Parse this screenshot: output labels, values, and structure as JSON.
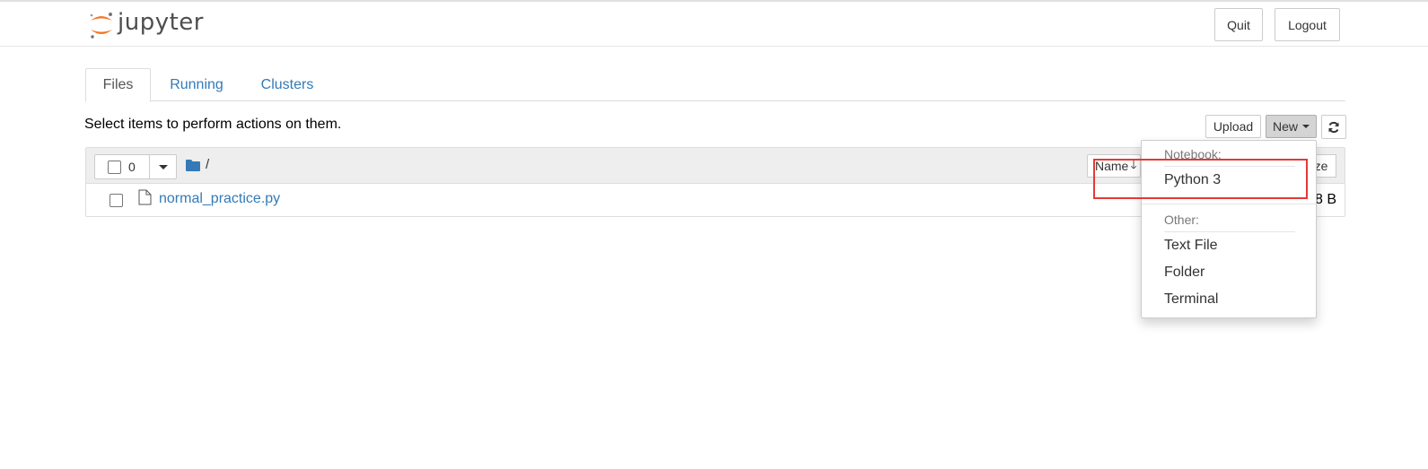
{
  "header": {
    "logo_text": "jupyter",
    "quit_label": "Quit",
    "logout_label": "Logout"
  },
  "tabs": [
    {
      "label": "Files",
      "active": true
    },
    {
      "label": "Running",
      "active": false
    },
    {
      "label": "Clusters",
      "active": false
    }
  ],
  "toolbar": {
    "hint": "Select items to perform actions on them.",
    "upload_label": "Upload",
    "new_label": "New"
  },
  "list": {
    "selected_count": "0",
    "breadcrumb_path": "/",
    "name_sort_label": "Name",
    "size_header_fragment": "ze",
    "files": [
      {
        "name": "normal_practice.py",
        "size_fragment": "8 B"
      }
    ]
  },
  "new_menu": {
    "notebook_header": "Notebook:",
    "python_label": "Python 3",
    "other_header": "Other:",
    "text_file_label": "Text File",
    "folder_label": "Folder",
    "terminal_label": "Terminal"
  },
  "colors": {
    "link": "#337ab7",
    "jupyter_orange": "#f37726",
    "highlight_red": "#e53935"
  }
}
